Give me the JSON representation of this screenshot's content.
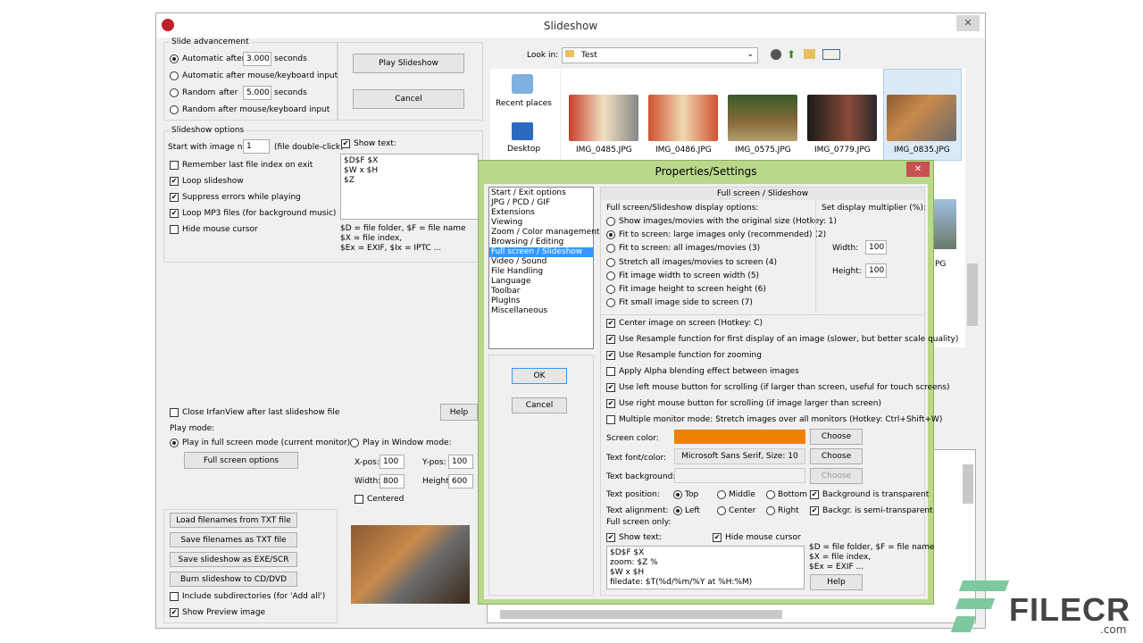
{
  "main": {
    "title": "Slideshow",
    "close": "✕"
  },
  "advance": {
    "group": "Slide advancement",
    "auto": "Automatic after",
    "auto_val": "3.000",
    "seconds": "seconds",
    "auto_input": "Automatic after mouse/keyboard input",
    "random": "Random",
    "after": "after",
    "rand_val": "5.000",
    "seconds2": "seconds",
    "rand_input": "Random   after mouse/keyboard input"
  },
  "buttons": {
    "play": "Play Slideshow",
    "cancel": "Cancel",
    "help": "Help",
    "fullscreen": "Full screen options"
  },
  "options": {
    "group": "Slideshow options",
    "start": "Start with image nr.:",
    "start_val": "1",
    "dbl": "(file double-click)",
    "remember": "Remember last file index on exit",
    "loop": "Loop slideshow",
    "suppress": "Suppress errors while playing",
    "loopmp3": "Loop MP3 files (for background music)",
    "hidecursor": "Hide mouse cursor",
    "showtext": "Show text:",
    "text": "$D$F $X\n$W x $H\n$Z",
    "legend1": "$D = file folder, $F = file name",
    "legend2": "$X = file index,",
    "legend3": "$Ex = EXIF, $Ix = IPTC ..."
  },
  "close_after": "Close IrfanView after last slideshow file",
  "playmode": {
    "group": "Play mode:",
    "full": "Play in full screen mode (current monitor)",
    "window": "Play in Window mode:",
    "xpos": "X-pos:",
    "xval": "100",
    "ypos": "Y-pos:",
    "yval": "100",
    "width": "Width:",
    "wval": "800",
    "height": "Height:",
    "hval": "600",
    "centered": "Centered"
  },
  "filebtns": {
    "load": "Load filenames from TXT file",
    "save": "Save filenames as TXT file",
    "exe": "Save slideshow as  EXE/SCR",
    "burn": "Burn slideshow to CD/DVD",
    "subdirs": "Include subdirectories (for 'Add all')",
    "preview": "Show Preview image"
  },
  "browser": {
    "lookin": "Look in:",
    "folder": "Test",
    "recent": "Recent places",
    "desktop": "Desktop",
    "files": [
      "IMG_0485.JPG",
      "IMG_0486.JPG",
      "IMG_0575.JPG",
      "IMG_0779.JPG",
      "IMG_0835.JPG"
    ],
    "partial": "PG"
  },
  "dlg": {
    "title": "Properties/Settings",
    "close": "✕",
    "ok": "OK",
    "cancel": "Cancel",
    "cats": [
      "Start / Exit options",
      "JPG / PCD / GIF",
      "Extensions",
      "Viewing",
      "Zoom / Color management",
      "Browsing / Editing",
      "Full screen / Slideshow",
      "Video / Sound",
      "File Handling",
      "Language",
      "Toolbar",
      "PlugIns",
      "Miscellaneous"
    ],
    "header": "Full screen / Slideshow",
    "disp": "Full screen/Slideshow display options:",
    "opts": [
      "Show images/movies with the original size (Hotkey: 1)",
      "Fit to screen: large images only (recommended) (2)",
      "Fit to screen: all images/movies (3)",
      "Stretch all images/movies to screen (4)",
      "Fit image width to screen width (5)",
      "Fit image height to screen height (6)",
      "Fit small image side to screen (7)"
    ],
    "mult": "Set display multiplier (%):",
    "width": "Width:",
    "wval": "100",
    "height": "Height:",
    "hval": "100",
    "checks": [
      "Center image on screen (Hotkey: C)",
      "Use Resample function for first display of an image (slower, but better scale quality)",
      "Use Resample function for zooming",
      "Apply Alpha blending effect between images",
      "Use left mouse button for scrolling (if larger than screen, useful for touch screens)",
      "Use right mouse button for scrolling (if image larger than screen)",
      "Multiple monitor mode: Stretch images over all monitors (Hotkey: Ctrl+Shift+W)"
    ],
    "screencolor": "Screen color:",
    "choose": "Choose",
    "font": "Text font/color:",
    "fontval": "Microsoft Sans Serif, Size: 10",
    "textbg": "Text background:",
    "textpos": "Text position:",
    "top": "Top",
    "middle": "Middle",
    "bottom": "Bottom",
    "bgtrans": "Background is transparent",
    "align": "Text alignment:",
    "left": "Left",
    "center": "Center",
    "right": "Right",
    "semi": "Backgr. is semi-transparent",
    "fsonly": "Full screen only:",
    "showtext": "Show text:",
    "hidemouse": "Hide mouse cursor",
    "text": "$D$F $X\nzoom: $Z %\n$W x $H\nfiledate: $T(%d/%m/%Y at %H:%M)",
    "leg1": "$D = file folder, $F = file name",
    "leg2": "$X = file index,",
    "leg3": "$Ex = EXIF ...",
    "help": "Help"
  },
  "colors": {
    "screen": "#f08000",
    "accent": "#3399ff",
    "dlgframe": "#b9d98a"
  },
  "watermark": {
    "name": "FILECR",
    "domain": ".com"
  }
}
